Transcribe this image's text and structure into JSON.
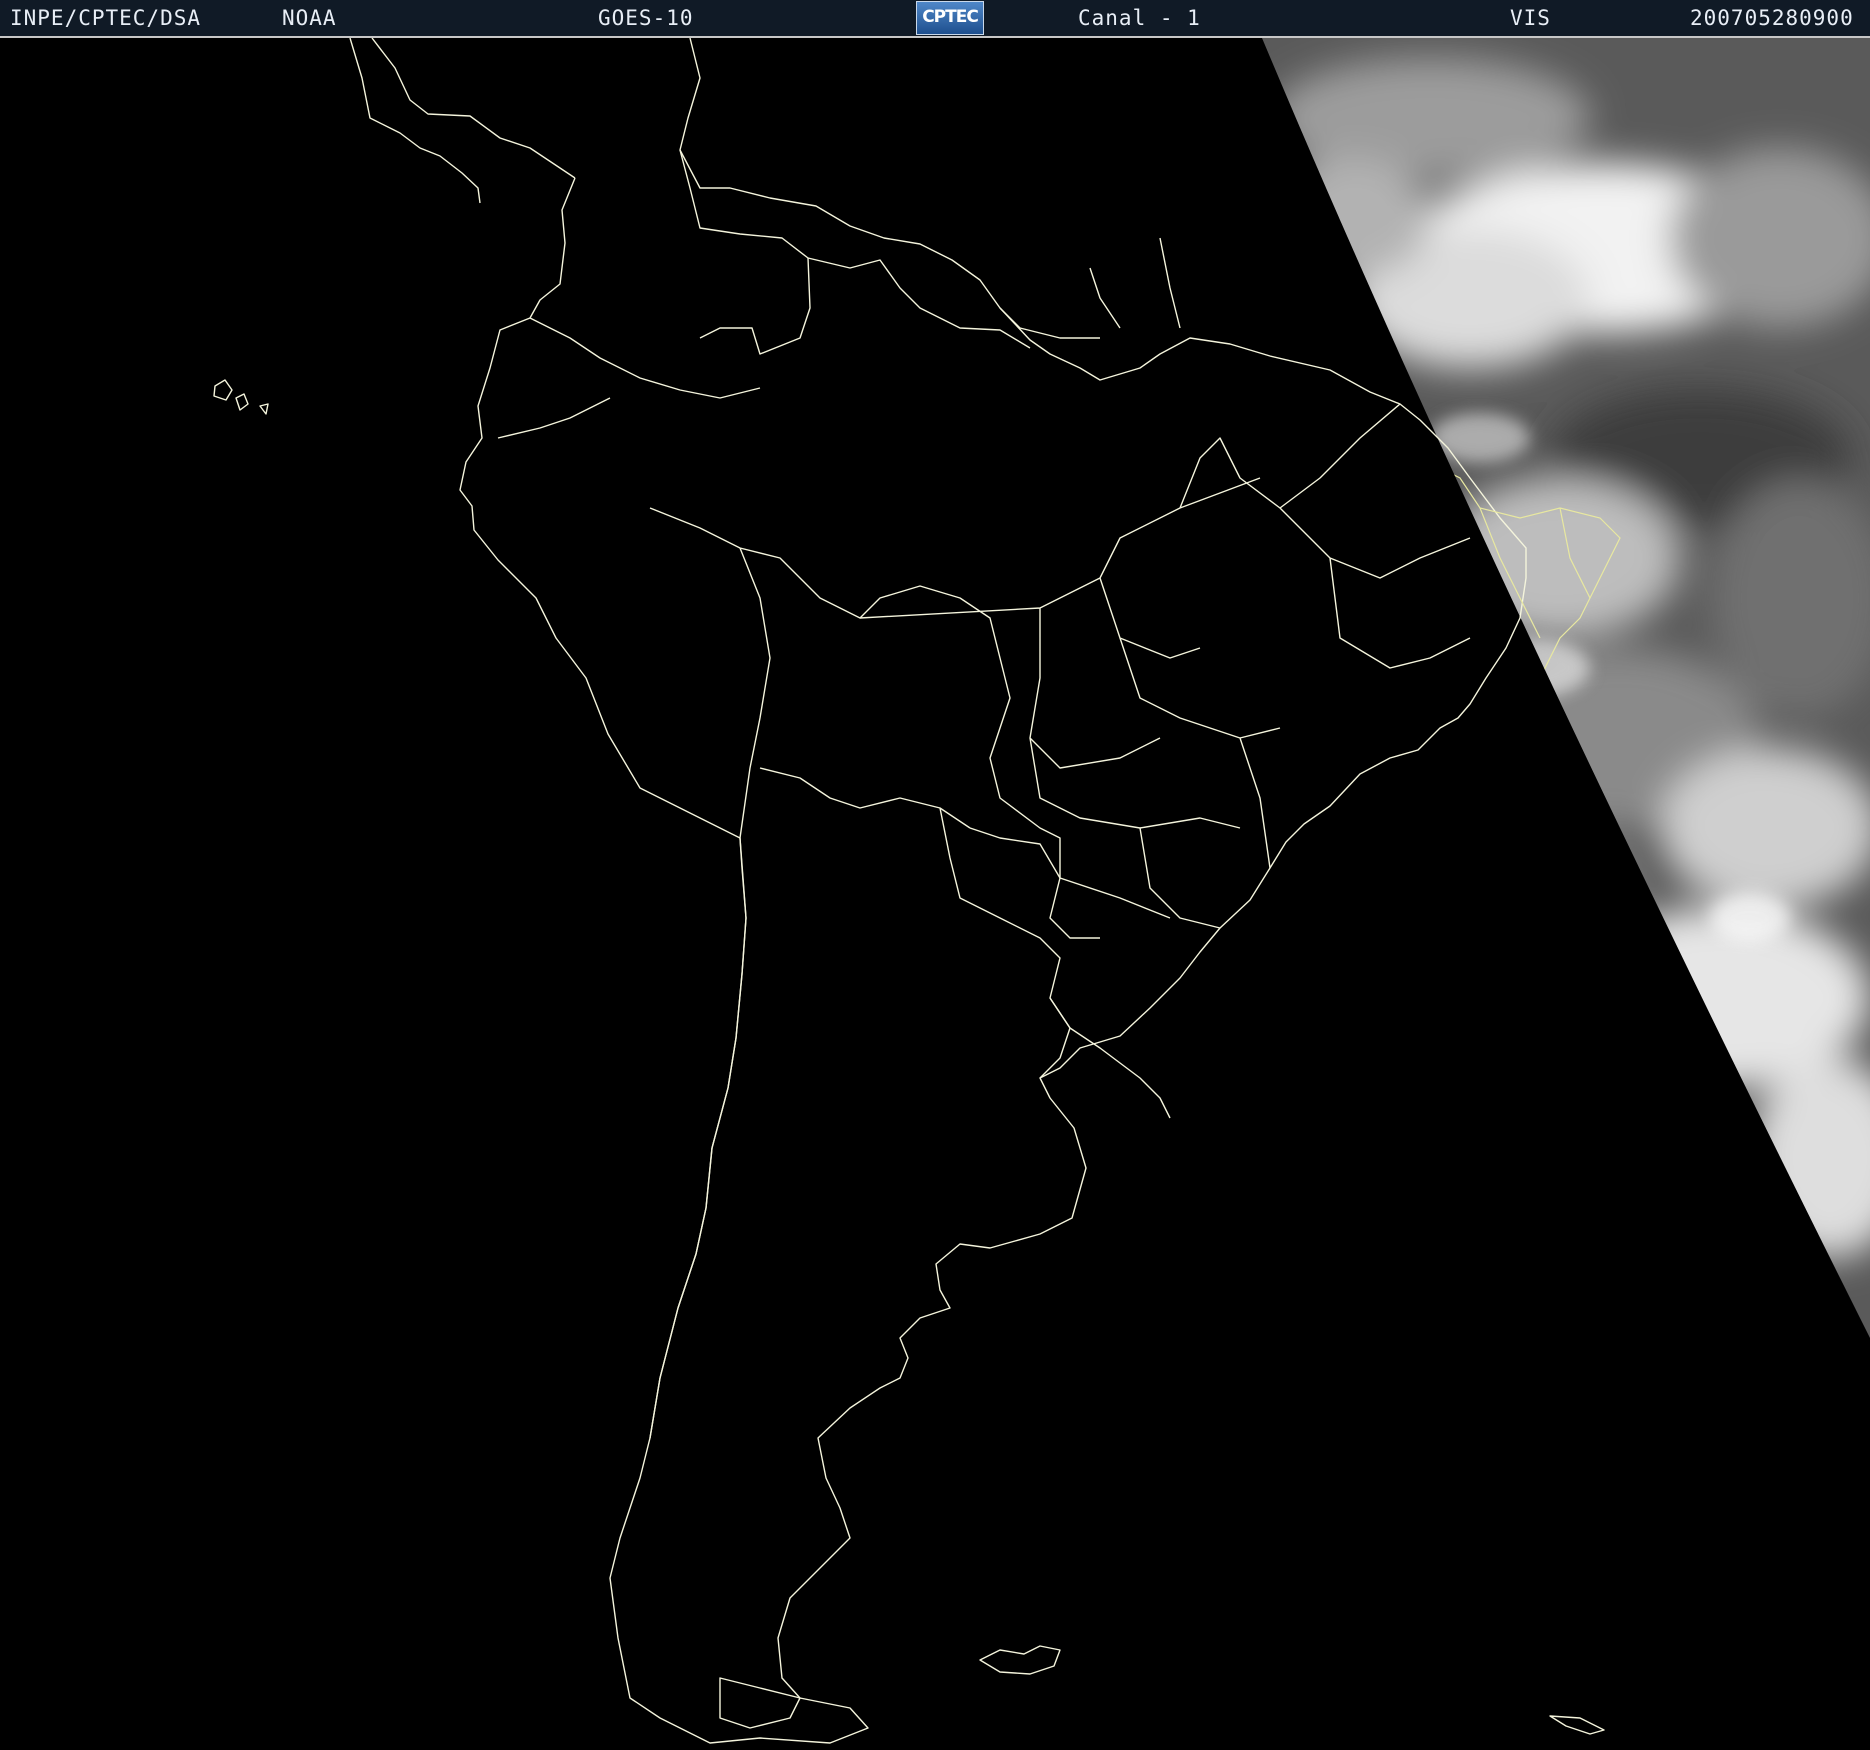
{
  "header": {
    "institution": "INPE/CPTEC/DSA",
    "agency": "NOAA",
    "satellite": "GOES-10",
    "logo_text": "CPTEC",
    "channel": "Canal - 1",
    "band": "VIS",
    "timestamp": "200705280900"
  },
  "map": {
    "region": "South America",
    "day_side": "east",
    "outline_color": "#f4f4dc",
    "background_color": "#000000",
    "cloud_color": "#d8d8d8"
  }
}
